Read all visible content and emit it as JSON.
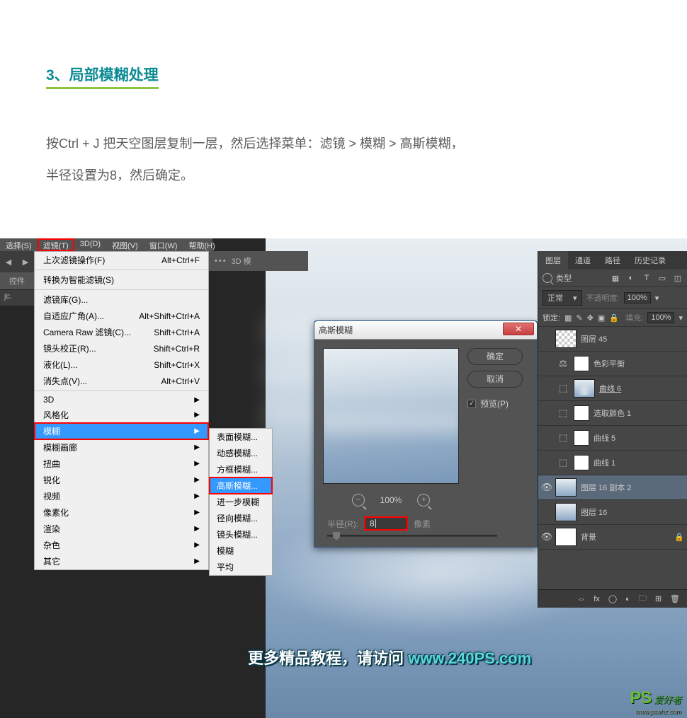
{
  "article": {
    "title": "3、局部模糊处理",
    "body_l1": "按Ctrl + J 把天空图层复制一层，然后选择菜单：滤镜 > 模糊 > 高斯模糊，",
    "body_l2": "半径设置为8，然后确定。"
  },
  "menubar": {
    "select": "选择(S)",
    "filter": "滤镜(T)",
    "threeD": "3D(D)",
    "view": "视图(V)",
    "window": "窗口(W)",
    "help": "帮助(H)"
  },
  "options": {
    "dots": "•••",
    "mode3d": "3D 模"
  },
  "side_tab": "控件",
  "file_tab": "jc.",
  "dropdown": {
    "last_filter": "上次滤镜操作(F)",
    "last_filter_sc": "Alt+Ctrl+F",
    "smart": "转换为智能滤镜(S)",
    "gallery": "滤镜库(G)...",
    "adaptive": "自适应广角(A)...",
    "adaptive_sc": "Alt+Shift+Ctrl+A",
    "camera_raw": "Camera Raw 滤镜(C)...",
    "camera_raw_sc": "Shift+Ctrl+A",
    "lens": "镜头校正(R)...",
    "lens_sc": "Shift+Ctrl+R",
    "liquify": "液化(L)...",
    "liquify_sc": "Shift+Ctrl+X",
    "vanish": "消失点(V)...",
    "vanish_sc": "Alt+Ctrl+V",
    "threeD": "3D",
    "stylize": "风格化",
    "blur": "模糊",
    "blur_gallery": "模糊画廊",
    "distort": "扭曲",
    "sharpen": "锐化",
    "video": "视频",
    "pixelate": "像素化",
    "render": "渲染",
    "noise": "杂色",
    "other": "其它"
  },
  "submenu": {
    "surface": "表面模糊...",
    "motion": "动感模糊...",
    "box": "方框模糊...",
    "gaussian": "高斯模糊...",
    "further": "进一步模糊",
    "radial": "径向模糊...",
    "lens": "镜头模糊...",
    "blur": "模糊",
    "average": "平均"
  },
  "dialog": {
    "title": "高斯模糊",
    "ok": "确定",
    "cancel": "取消",
    "preview": "预览(P)",
    "zoom": "100%",
    "radius_label": "半径(R):",
    "radius_value": "8",
    "px": "像素"
  },
  "layers_panel": {
    "tabs": {
      "layers": "图层",
      "channels": "通道",
      "paths": "路径",
      "history": "历史记录"
    },
    "type_label": "类型",
    "blend": "正常",
    "opacity_label": "不透明度:",
    "opacity_value": "100%",
    "lock_label": "锁定:",
    "fill_label": "填充:",
    "fill_value": "100%",
    "layers": {
      "l45": "图层 45",
      "color_balance": "色彩平衡",
      "curves6": "曲线 6",
      "sel_color1": "选取颜色 1",
      "curves5": "曲线 5",
      "curves1": "曲线 1",
      "l16copy2": "图层 16 副本 2",
      "l16": "图层 16",
      "bg": "背景"
    }
  },
  "promo": {
    "text": "更多精品教程，请访问 ",
    "url": "www.240PS.com"
  },
  "watermark": {
    "logo": "PS",
    "cn": "爱好者",
    "sub": "www.psahz.com"
  }
}
